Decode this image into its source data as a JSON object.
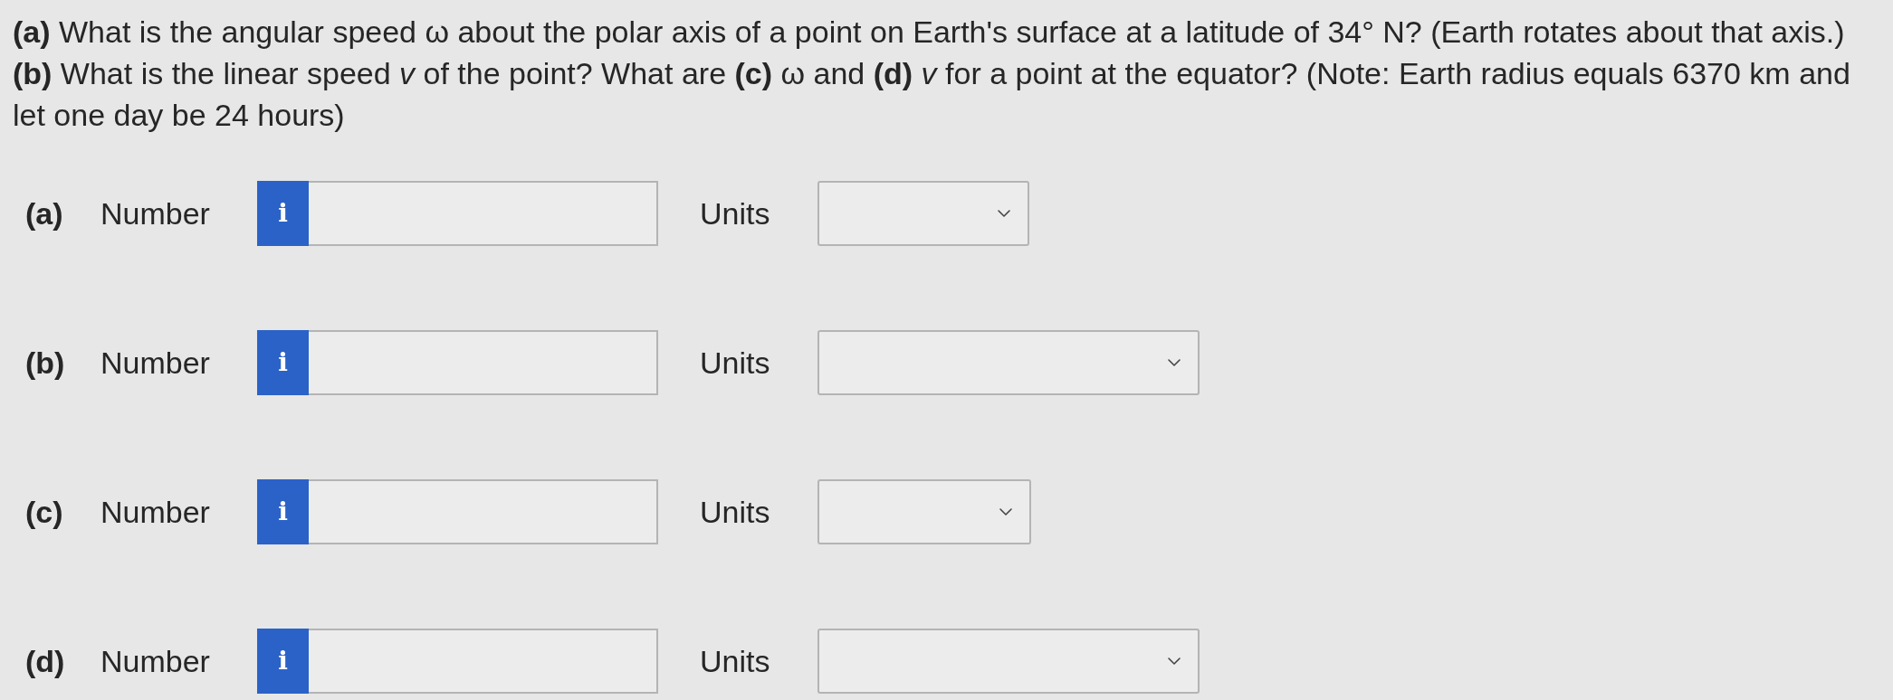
{
  "question": [
    "**(a)** What is the angular speed ω about the polar axis of a point on Earth's surface at a latitude of 34° N? (Earth rotates about that axis.)",
    "**(b)** What is the linear speed *v* of the point? What are **(c)** ω and **(d)** *v* for a point at the equator? (Note: Earth radius equals 6370 km and let one day be 24 hours)"
  ],
  "parts": [
    {
      "label": "(a)",
      "number_label": "Number",
      "info": "i",
      "units_label": "Units"
    },
    {
      "label": "(b)",
      "number_label": "Number",
      "info": "i",
      "units_label": "Units"
    },
    {
      "label": "(c)",
      "number_label": "Number",
      "info": "i",
      "units_label": "Units"
    },
    {
      "label": "(d)",
      "number_label": "Number",
      "info": "i",
      "units_label": "Units"
    }
  ]
}
